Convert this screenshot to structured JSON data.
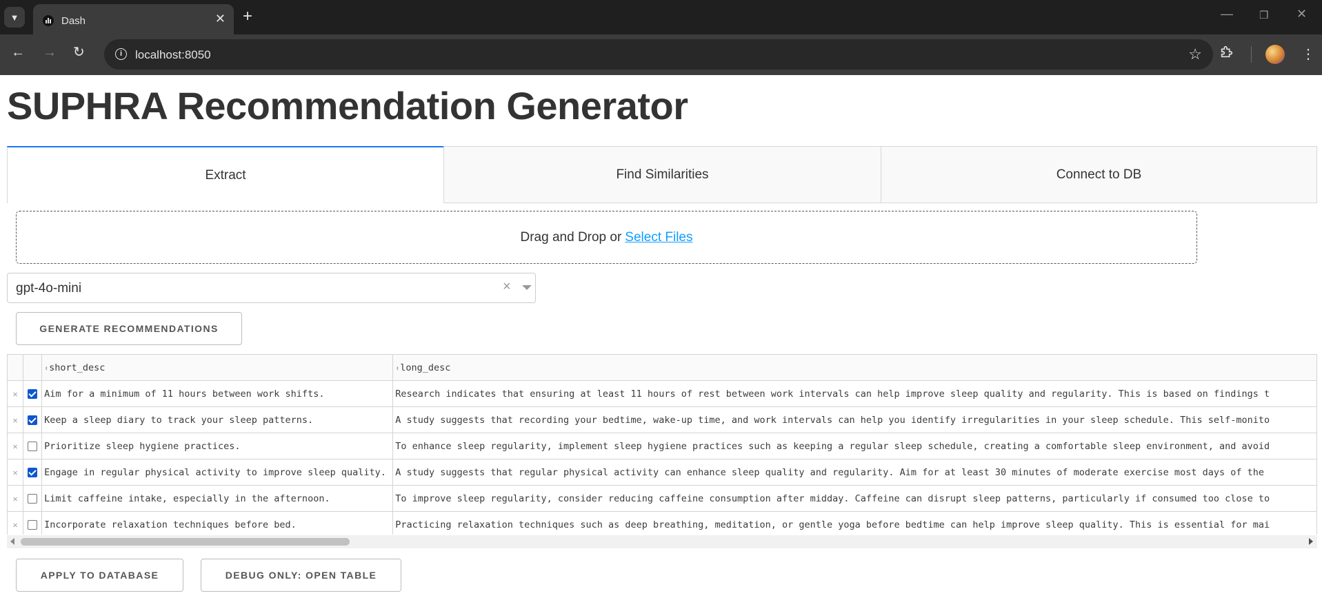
{
  "browser": {
    "tab_title": "Dash",
    "url": "localhost:8050"
  },
  "page": {
    "title": "SUPHRA Recommendation Generator"
  },
  "tabs": [
    {
      "label": "Extract",
      "active": true
    },
    {
      "label": "Find Similarities",
      "active": false
    },
    {
      "label": "Connect to DB",
      "active": false
    }
  ],
  "upload": {
    "prefix": "Drag and Drop or",
    "link": "Select Files"
  },
  "model_dropdown": {
    "value": "gpt-4o-mini"
  },
  "buttons": {
    "generate": "Generate Recommendations",
    "apply": "Apply to Database",
    "debug": "Debug Only: Open Table"
  },
  "table": {
    "columns": [
      "short_desc",
      "long_desc"
    ],
    "rows": [
      {
        "selected": true,
        "short_desc": "Aim for a minimum of 11 hours between work shifts.",
        "long_desc": "Research indicates that ensuring at least 11 hours of rest between work intervals can help improve sleep quality and regularity. This is based on findings t"
      },
      {
        "selected": true,
        "short_desc": "Keep a sleep diary to track your sleep patterns.",
        "long_desc": "A study suggests that recording your bedtime, wake-up time, and work intervals can help you identify irregularities in your sleep schedule. This self-monito"
      },
      {
        "selected": false,
        "short_desc": "Prioritize sleep hygiene practices.",
        "long_desc": "To enhance sleep regularity, implement sleep hygiene practices such as keeping a regular sleep schedule, creating a comfortable sleep environment, and avoid"
      },
      {
        "selected": true,
        "short_desc": "Engage in regular physical activity to improve sleep quality.",
        "long_desc": "A study suggests that regular physical activity can enhance sleep quality and regularity. Aim for at least 30 minutes of moderate exercise most days of the"
      },
      {
        "selected": false,
        "short_desc": "Limit caffeine intake, especially in the afternoon.",
        "long_desc": "To improve sleep regularity, consider reducing caffeine consumption after midday. Caffeine can disrupt sleep patterns, particularly if consumed too close to"
      },
      {
        "selected": false,
        "short_desc": "Incorporate relaxation techniques before bed.",
        "long_desc": "Practicing relaxation techniques such as deep breathing, meditation, or gentle yoga before bedtime can help improve sleep quality. This is essential for mai"
      }
    ]
  },
  "colors": {
    "active_tab_border": "#1975fa",
    "link": "#119dff",
    "checkbox": "#0b57d0"
  }
}
